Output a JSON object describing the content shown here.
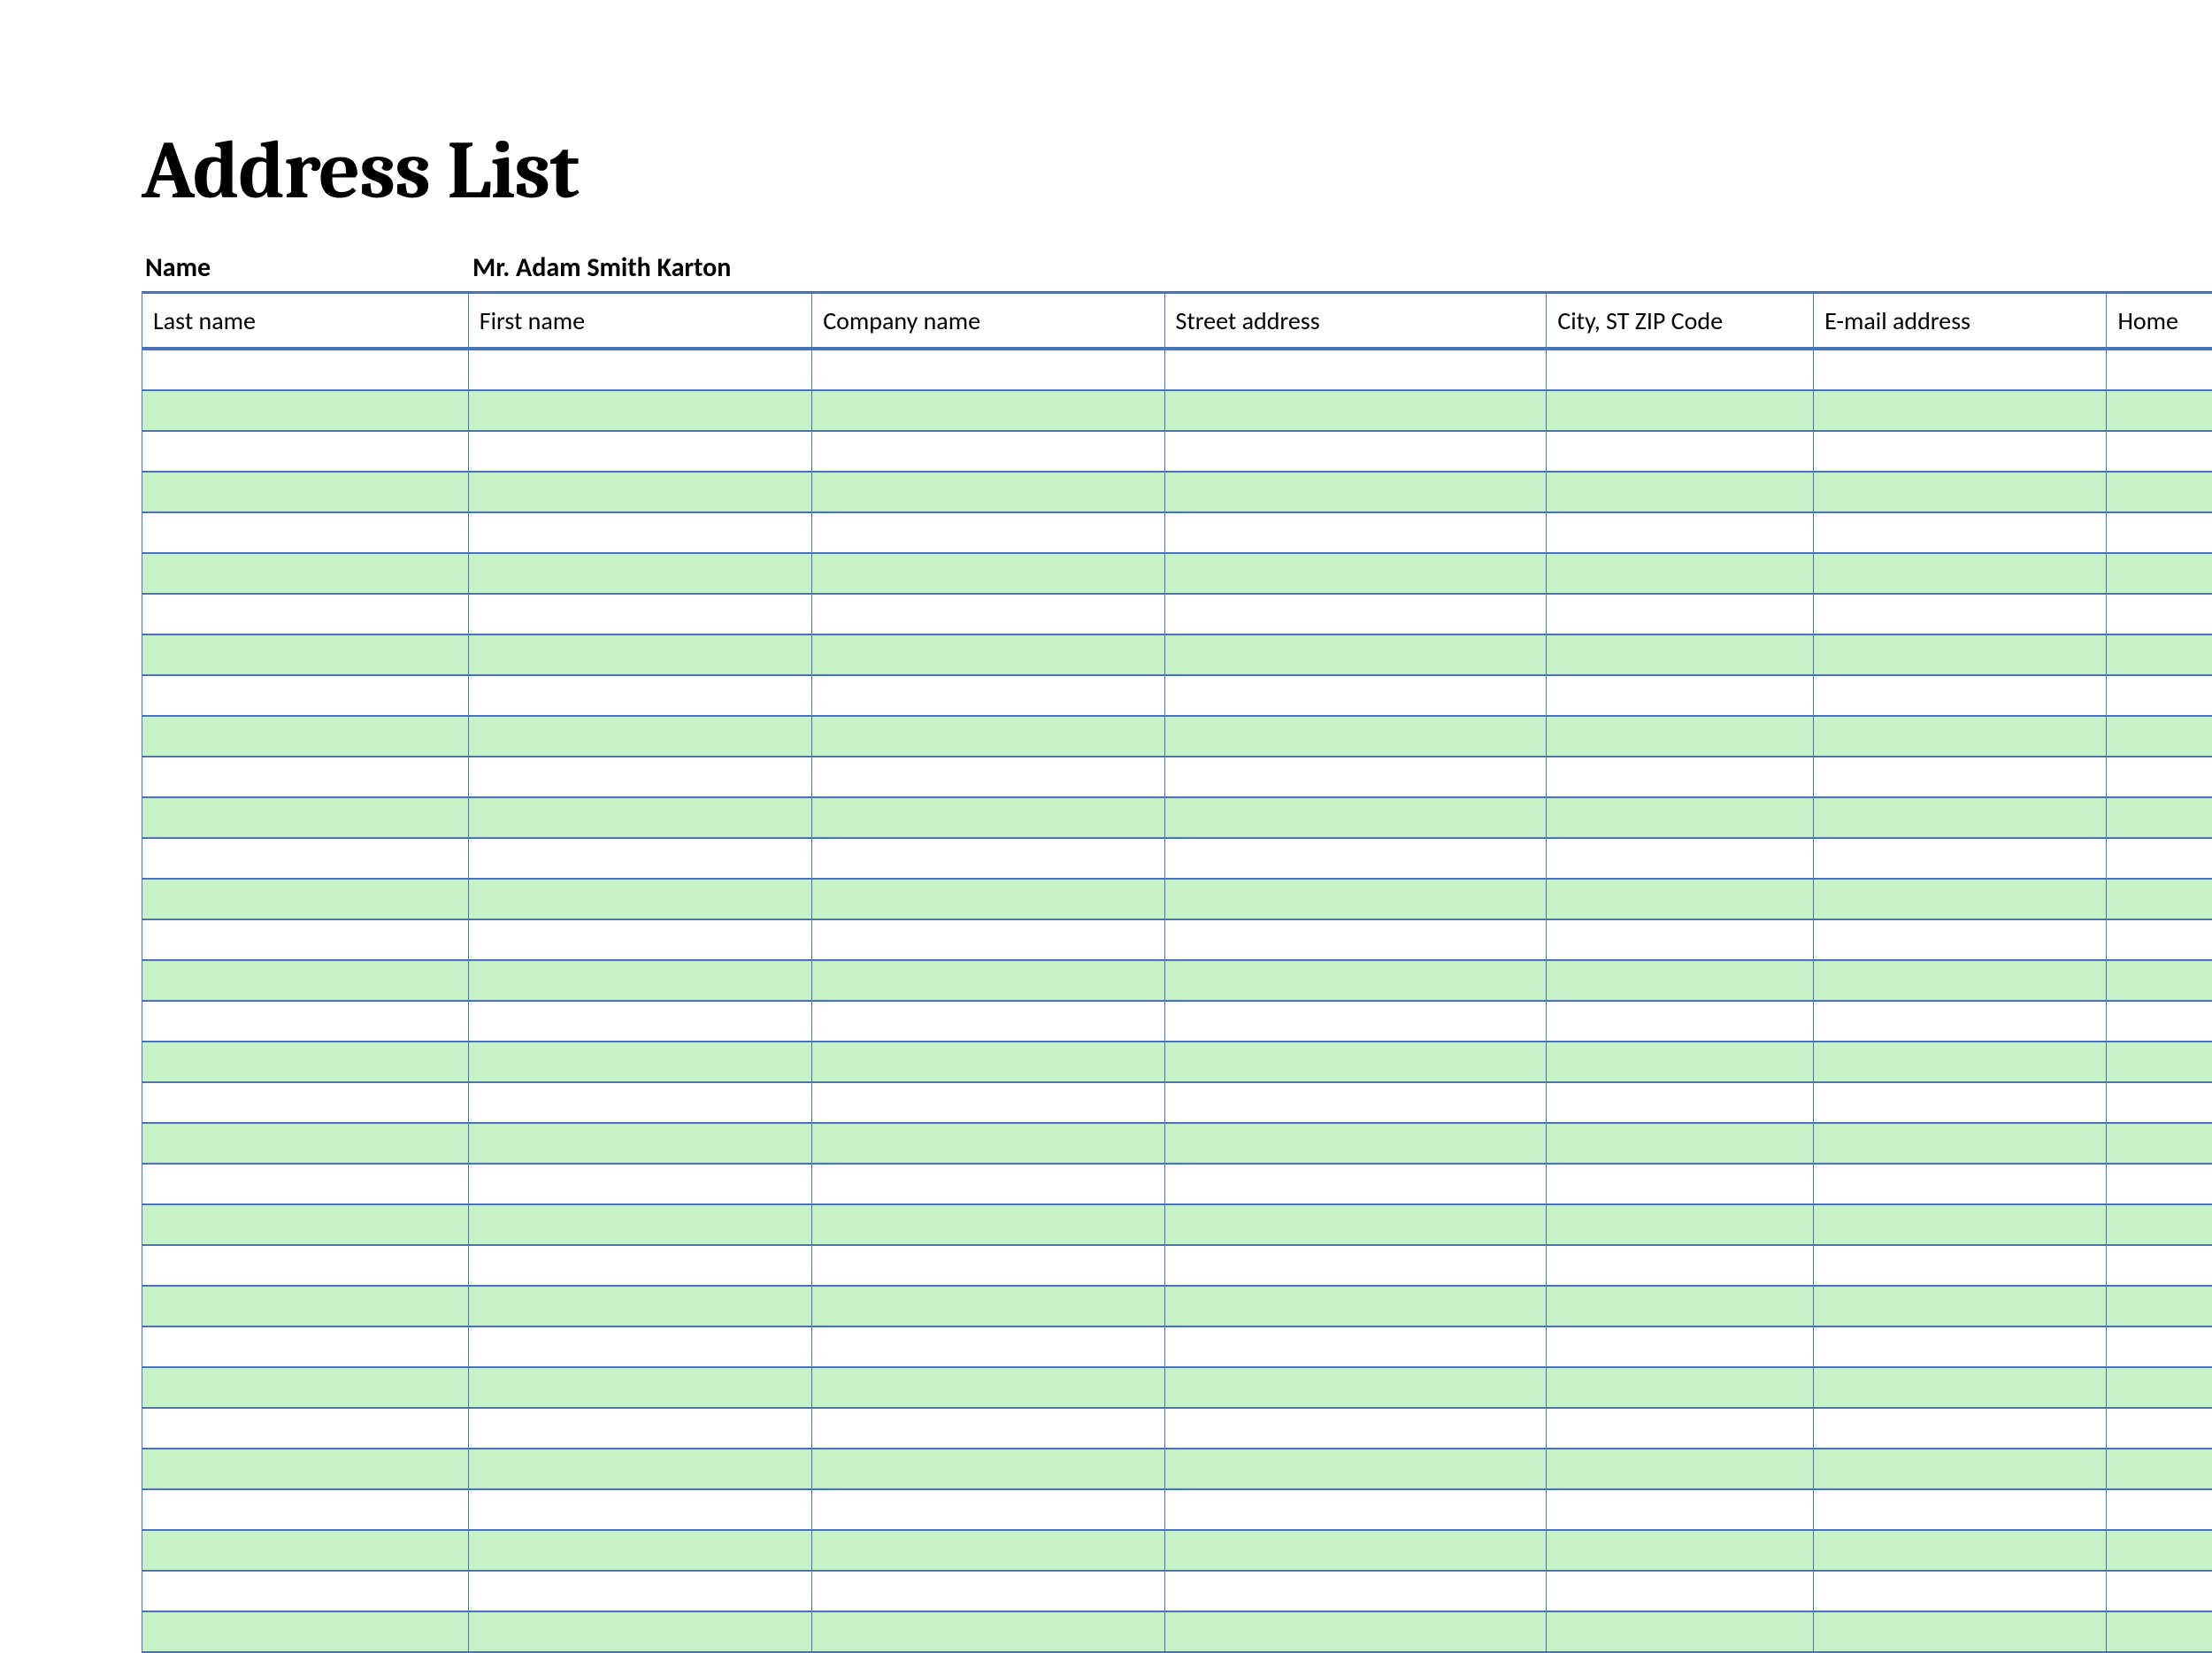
{
  "title": "Address List",
  "name_label": "Name",
  "name_value": "Mr. Adam Smith Karton",
  "columns": [
    "Last name",
    "First name",
    "Company name",
    "Street address",
    "City, ST  ZIP Code",
    "E-mail address",
    "Home"
  ],
  "rows": [
    [
      "",
      "",
      "",
      "",
      "",
      "",
      ""
    ],
    [
      "",
      "",
      "",
      "",
      "",
      "",
      ""
    ],
    [
      "",
      "",
      "",
      "",
      "",
      "",
      ""
    ],
    [
      "",
      "",
      "",
      "",
      "",
      "",
      ""
    ],
    [
      "",
      "",
      "",
      "",
      "",
      "",
      ""
    ],
    [
      "",
      "",
      "",
      "",
      "",
      "",
      ""
    ],
    [
      "",
      "",
      "",
      "",
      "",
      "",
      ""
    ],
    [
      "",
      "",
      "",
      "",
      "",
      "",
      ""
    ],
    [
      "",
      "",
      "",
      "",
      "",
      "",
      ""
    ],
    [
      "",
      "",
      "",
      "",
      "",
      "",
      ""
    ],
    [
      "",
      "",
      "",
      "",
      "",
      "",
      ""
    ],
    [
      "",
      "",
      "",
      "",
      "",
      "",
      ""
    ],
    [
      "",
      "",
      "",
      "",
      "",
      "",
      ""
    ],
    [
      "",
      "",
      "",
      "",
      "",
      "",
      ""
    ],
    [
      "",
      "",
      "",
      "",
      "",
      "",
      ""
    ],
    [
      "",
      "",
      "",
      "",
      "",
      "",
      ""
    ],
    [
      "",
      "",
      "",
      "",
      "",
      "",
      ""
    ],
    [
      "",
      "",
      "",
      "",
      "",
      "",
      ""
    ],
    [
      "",
      "",
      "",
      "",
      "",
      "",
      ""
    ],
    [
      "",
      "",
      "",
      "",
      "",
      "",
      ""
    ],
    [
      "",
      "",
      "",
      "",
      "",
      "",
      ""
    ],
    [
      "",
      "",
      "",
      "",
      "",
      "",
      ""
    ],
    [
      "",
      "",
      "",
      "",
      "",
      "",
      ""
    ],
    [
      "",
      "",
      "",
      "",
      "",
      "",
      ""
    ],
    [
      "",
      "",
      "",
      "",
      "",
      "",
      ""
    ],
    [
      "",
      "",
      "",
      "",
      "",
      "",
      ""
    ],
    [
      "",
      "",
      "",
      "",
      "",
      "",
      ""
    ],
    [
      "",
      "",
      "",
      "",
      "",
      "",
      ""
    ],
    [
      "",
      "",
      "",
      "",
      "",
      "",
      ""
    ],
    [
      "",
      "",
      "",
      "",
      "",
      "",
      ""
    ],
    [
      "",
      "",
      "",
      "",
      "",
      "",
      ""
    ],
    [
      "",
      "",
      "",
      "",
      "",
      "",
      ""
    ]
  ]
}
